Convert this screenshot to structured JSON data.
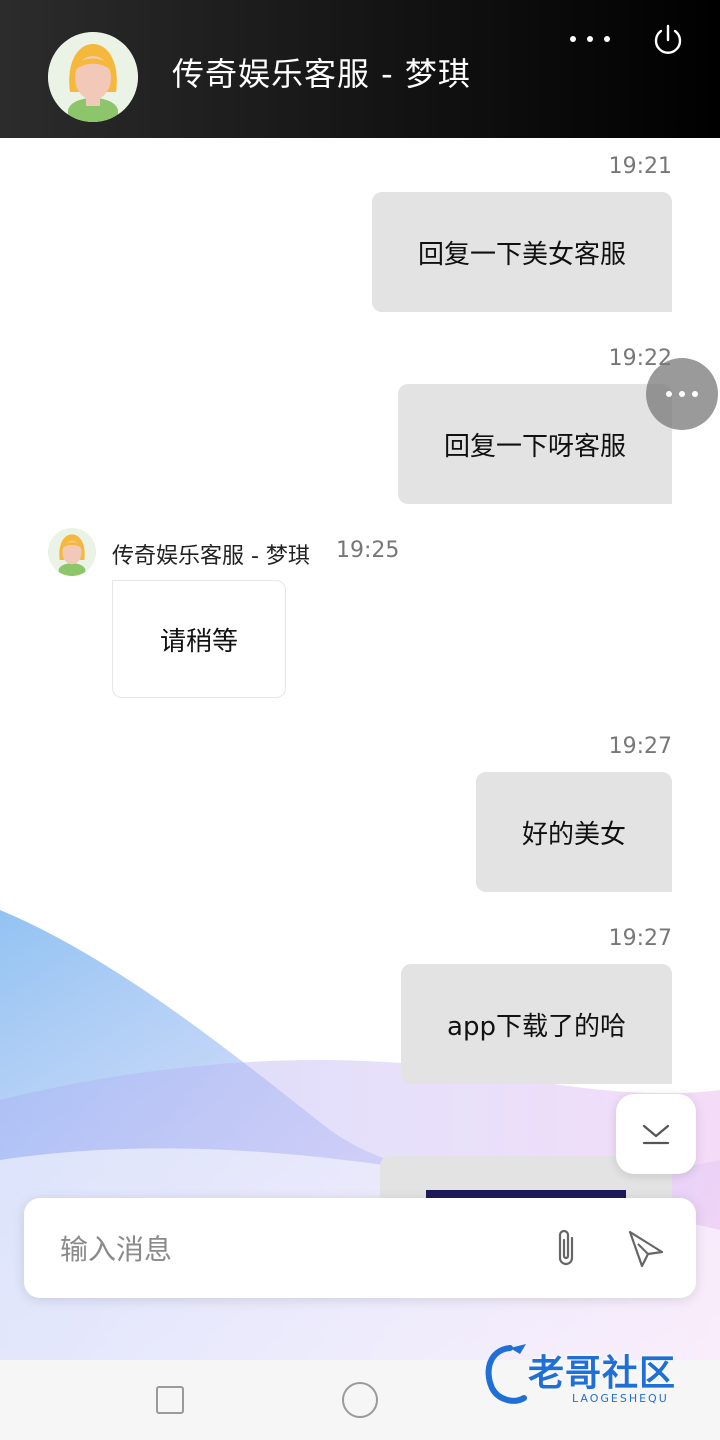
{
  "header": {
    "title": "传奇娱乐客服 - 梦琪"
  },
  "messages": [
    {
      "direction": "out",
      "time": "19:21",
      "text": "回复一下美女客服"
    },
    {
      "direction": "out",
      "time": "19:22",
      "text": "回复一下呀客服"
    },
    {
      "direction": "in",
      "sender": "传奇娱乐客服 - 梦琪",
      "time": "19:25",
      "text": "请稍等"
    },
    {
      "direction": "out",
      "time": "19:27",
      "text": "好的美女"
    },
    {
      "direction": "out",
      "time": "19:27",
      "text": "app下载了的哈"
    }
  ],
  "composer": {
    "placeholder": "输入消息"
  },
  "watermark": {
    "text": "老哥社区",
    "sub": "LAOGESHEQU"
  },
  "colors": {
    "header_bg": "#111111",
    "bubble_out": "#e3e3e3",
    "watermark": "#1f6fd6"
  }
}
